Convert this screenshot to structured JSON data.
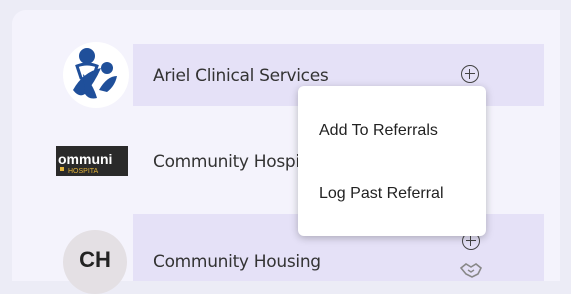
{
  "providers": [
    {
      "name": "Ariel Clinical Services",
      "logo": "ariel-clinical-services-logo"
    },
    {
      "name": "Community Hospit",
      "logo": "community-hospital-logo",
      "logo_text_top": "ommuni",
      "logo_text_bottom": "HOSPITA"
    },
    {
      "name": "Community Housing",
      "logo": "initials-avatar",
      "initials": "CH"
    }
  ],
  "menu": {
    "items": [
      "Add To Referrals",
      "Log Past Referral"
    ]
  },
  "icons": [
    "add-circle-icon",
    "handshake-icon"
  ],
  "colors": {
    "background": "#ececf6",
    "panel": "#f4f3fc",
    "row_highlight": "#e5e1f7",
    "ariel_blue": "#1f4f9a"
  }
}
